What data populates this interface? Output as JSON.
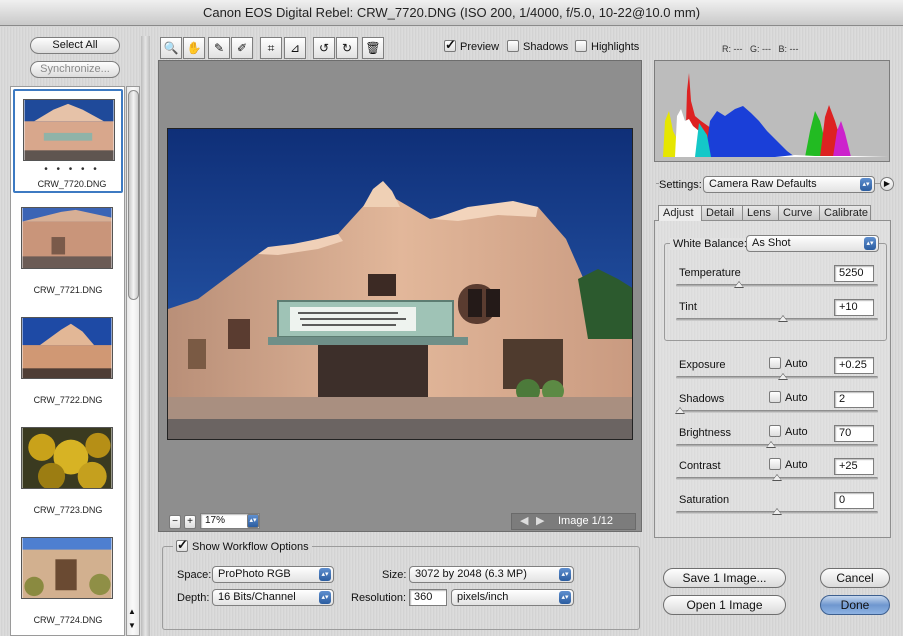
{
  "window": {
    "title": "Canon EOS Digital Rebel:  CRW_7720.DNG  (ISO 200, 1/4000, f/5.0, 10-22@10.0 mm)"
  },
  "left": {
    "select_all": "Select All",
    "synchronize": "Synchronize...",
    "rating_dots": "• • • • •",
    "filmstrip": [
      {
        "caption": "CRW_7720.DNG"
      },
      {
        "caption": "CRW_7721.DNG"
      },
      {
        "caption": "CRW_7722.DNG"
      },
      {
        "caption": "CRW_7723.DNG"
      },
      {
        "caption": "CRW_7724.DNG"
      }
    ]
  },
  "toolbar": {
    "tools": [
      {
        "name": "zoom-tool-icon",
        "glyph": "🔍"
      },
      {
        "name": "hand-tool-icon",
        "glyph": "✋"
      },
      {
        "name": "white-balance-tool-icon",
        "glyph": "✎"
      },
      {
        "name": "color-sampler-tool-icon",
        "glyph": "✐"
      },
      {
        "name": "crop-tool-icon",
        "glyph": "⌗"
      },
      {
        "name": "straighten-tool-icon",
        "glyph": "⊿"
      },
      {
        "name": "rotate-left-icon",
        "glyph": "↺"
      },
      {
        "name": "rotate-right-icon",
        "glyph": "↻"
      },
      {
        "name": "trash-icon",
        "glyph": "🗑"
      }
    ],
    "preview_label": "Preview",
    "shadows_label": "Shadows",
    "highlights_label": "Highlights",
    "rgb_readout": "R: ---   G: ---   B: ---"
  },
  "status": {
    "zoom": "17%",
    "image_counter": "Image 1/12"
  },
  "workflow": {
    "show_label": "Show Workflow Options",
    "space_label": "Space:",
    "space_value": "ProPhoto RGB",
    "depth_label": "Depth:",
    "depth_value": "16 Bits/Channel",
    "size_label": "Size:",
    "size_value": "3072 by 2048  (6.3 MP)",
    "resolution_label": "Resolution:",
    "resolution_value": "360",
    "resolution_unit": "pixels/inch"
  },
  "settings": {
    "label": "Settings:",
    "value": "Camera Raw Defaults",
    "tabs": [
      "Adjust",
      "Detail",
      "Lens",
      "Curve",
      "Calibrate"
    ],
    "white_balance_label": "White Balance:",
    "white_balance_value": "As Shot",
    "sliders": [
      {
        "label": "Temperature",
        "value": "5250",
        "level": 0.31,
        "auto": false
      },
      {
        "label": "Tint",
        "value": "+10",
        "level": 0.53,
        "auto": false
      },
      {
        "label": "Exposure",
        "value": "+0.25",
        "level": 0.53,
        "auto": true
      },
      {
        "label": "Shadows",
        "value": "2",
        "level": 0.02,
        "auto": true
      },
      {
        "label": "Brightness",
        "value": "70",
        "level": 0.47,
        "auto": true
      },
      {
        "label": "Contrast",
        "value": "+25",
        "level": 0.5,
        "auto": true
      },
      {
        "label": "Saturation",
        "value": "0",
        "level": 0.5,
        "auto": false
      }
    ],
    "auto_label": "Auto"
  },
  "buttons": {
    "save": "Save 1 Image...",
    "open": "Open 1 Image",
    "cancel": "Cancel",
    "done": "Done"
  },
  "colors": {
    "accent": "#3d7ac2",
    "sky": "#1f3f8f",
    "building": "#d8a88c"
  }
}
